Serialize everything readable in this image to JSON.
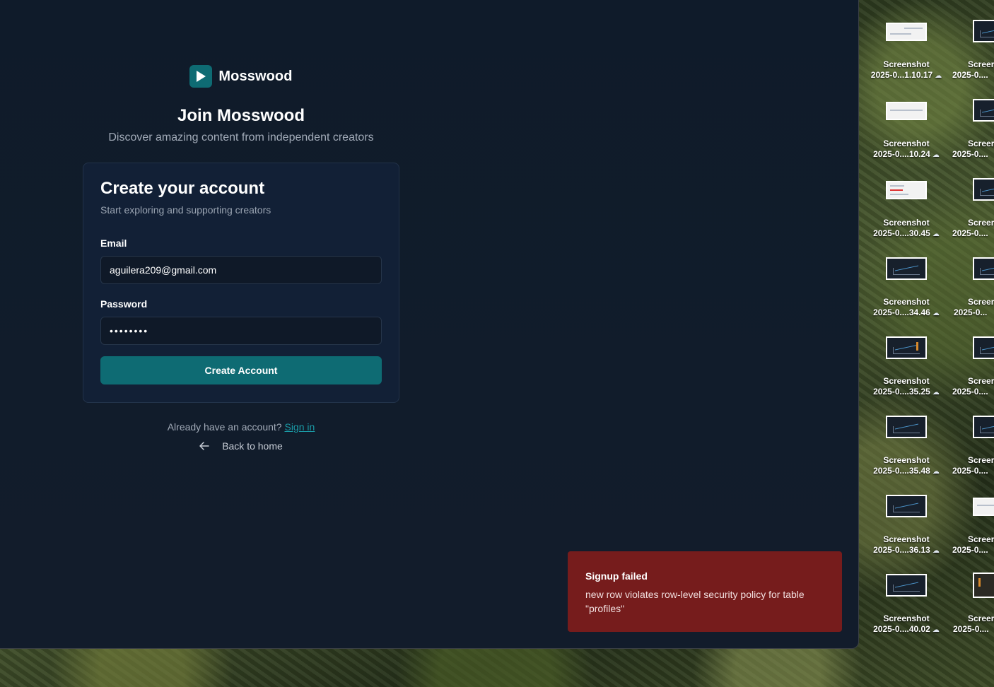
{
  "app": {
    "brand_name": "Mosswood",
    "join_title": "Join Mosswood",
    "join_subtitle": "Discover amazing content from independent creators"
  },
  "form": {
    "title": "Create your account",
    "subtitle": "Start exploring and supporting creators",
    "email_label": "Email",
    "email_value": "aguilera209@gmail.com",
    "password_label": "Password",
    "password_value": "••••••••",
    "submit_label": "Create Account"
  },
  "footer": {
    "signin_prompt": "Already have an account?",
    "signin_link": "Sign in",
    "back_label": "Back to home"
  },
  "toast": {
    "title": "Signup failed",
    "message": "new row violates row-level security policy for table \"profiles\""
  },
  "desktop": {
    "icons": [
      {
        "line1": "Screenshot",
        "line2": "2025-0...1.10.17"
      },
      {
        "line1": "Screenshot",
        "line2": "2025-0....10.24"
      },
      {
        "line1": "Screenshot",
        "line2": "2025-0....30.45"
      },
      {
        "line1": "Screenshot",
        "line2": "2025-0....34.46"
      },
      {
        "line1": "Screenshot",
        "line2": "2025-0....35.25"
      },
      {
        "line1": "Screenshot",
        "line2": "2025-0....35.48"
      },
      {
        "line1": "Screenshot",
        "line2": "2025-0....36.13"
      },
      {
        "line1": "Screenshot",
        "line2": "2025-0....40.02"
      }
    ],
    "icons_col2": [
      {
        "line1": "Screer",
        "line2": "2025-0...."
      },
      {
        "line1": "Screer",
        "line2": "2025-0...."
      },
      {
        "line1": "Screer",
        "line2": "2025-0...."
      },
      {
        "line1": "Screer",
        "line2": "2025-0..."
      },
      {
        "line1": "Screer",
        "line2": "2025-0...."
      },
      {
        "line1": "Screer",
        "line2": "2025-0...."
      },
      {
        "line1": "Screer",
        "line2": "2025-0...."
      },
      {
        "line1": "Screer",
        "line2": "2025-0...."
      }
    ]
  },
  "colors": {
    "accent": "#0e6b73",
    "link": "#1a9aa6",
    "toast_bg": "#761c1c",
    "window_bg": "#111c2b",
    "card_bg": "#122036"
  }
}
